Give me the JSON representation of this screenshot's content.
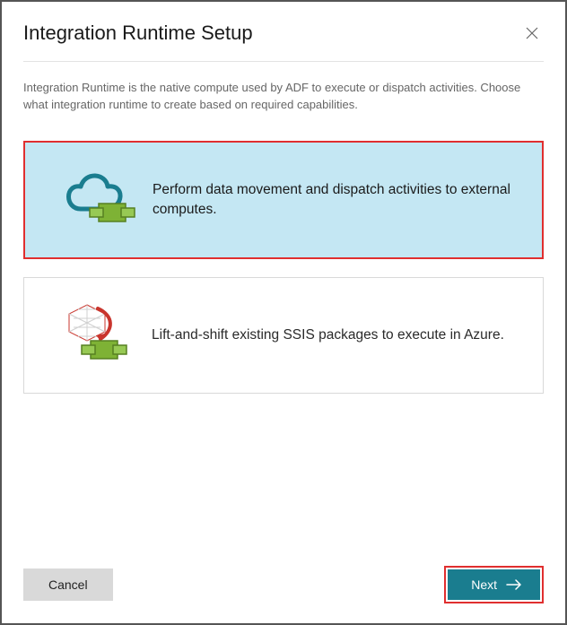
{
  "header": {
    "title": "Integration Runtime Setup"
  },
  "description": "Integration Runtime is the native compute used by ADF to execute or dispatch activities. Choose what integration runtime to create based on required capabilities.",
  "options": {
    "cloud": {
      "label": "Perform data movement and dispatch activities to external computes."
    },
    "ssis": {
      "label": "Lift-and-shift existing SSIS packages to execute in Azure."
    }
  },
  "footer": {
    "cancel_label": "Cancel",
    "next_label": "Next"
  },
  "icons": {
    "cloud": "cloud-shift-icon",
    "ssis": "ssis-shift-icon",
    "close": "close-icon",
    "arrow": "arrow-right-icon"
  },
  "colors": {
    "accent": "#1a7d8f",
    "highlight": "#e02f2f",
    "selected_bg": "#c4e7f3",
    "green": "#7EB235"
  }
}
